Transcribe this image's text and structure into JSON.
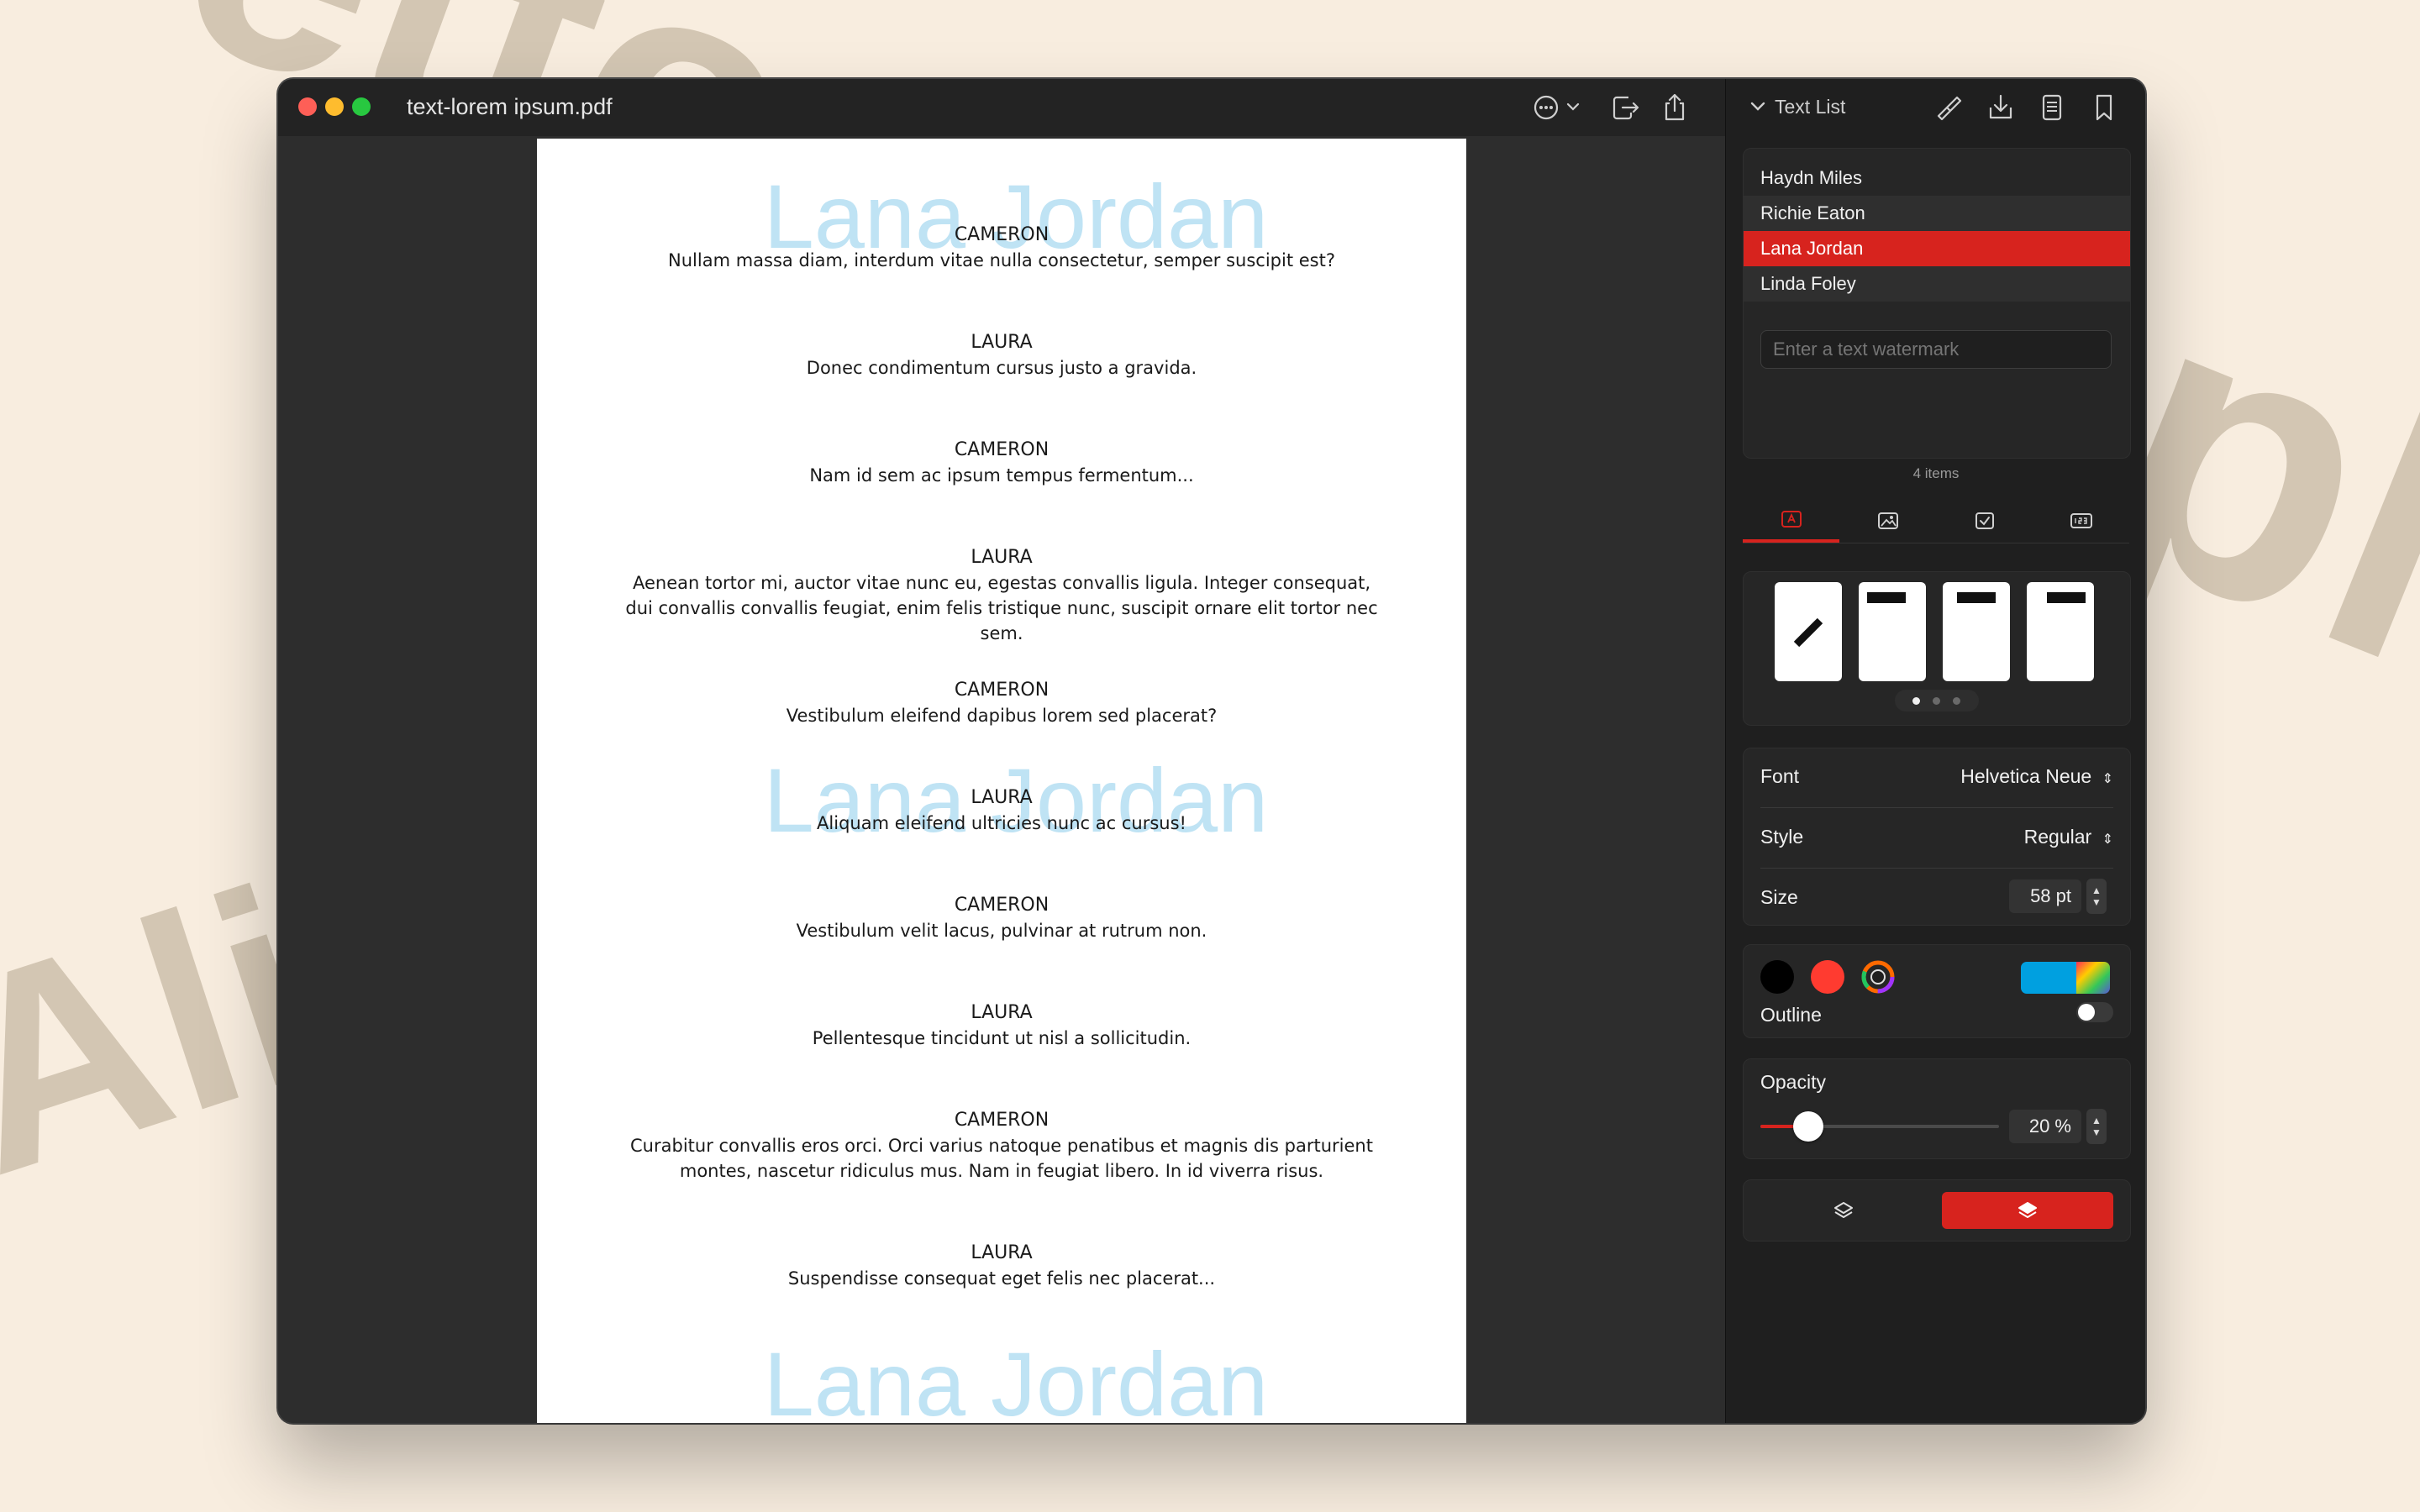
{
  "background": {
    "decor_1": "etto",
    "decor_2": "Alici",
    "decor_3": "ph"
  },
  "window": {
    "title": "text-lorem ipsum.pdf",
    "toolbar": {
      "more_icon": "ellipsis-circle-icon",
      "chevron_icon": "chevron-down-icon",
      "export_icon": "export-icon",
      "share_icon": "share-icon"
    }
  },
  "document": {
    "watermark_text": "Lana Jordan",
    "watermark_color": "#bfe3f4",
    "blocks": [
      {
        "speaker": "CAMERON",
        "text": "Nullam massa diam, interdum vitae nulla consectetur, semper suscipit est?"
      },
      {
        "speaker": "LAURA",
        "text": "Donec condimentum cursus justo a gravida."
      },
      {
        "speaker": "CAMERON",
        "text": "Nam id sem ac ipsum tempus fermentum..."
      },
      {
        "speaker": "LAURA",
        "text": "Aenean tortor mi, auctor vitae nunc eu, egestas convallis ligula. Integer consequat, dui convallis convallis feugiat, enim felis tristique nunc, suscipit ornare elit tortor nec sem."
      },
      {
        "speaker": "CAMERON",
        "text": "Vestibulum eleifend dapibus lorem sed placerat?"
      },
      {
        "speaker": "LAURA",
        "text": "Aliquam eleifend ultricies nunc ac cursus!"
      },
      {
        "speaker": "CAMERON",
        "text": "Vestibulum velit lacus, pulvinar at rutrum non."
      },
      {
        "speaker": "LAURA",
        "text": "Pellentesque tincidunt ut nisl a sollicitudin."
      },
      {
        "speaker": "CAMERON",
        "text": "Curabitur convallis eros orci. Orci varius natoque penatibus et magnis dis parturient montes, nascetur ridiculus mus. Nam in feugiat libero. In id viverra risus."
      },
      {
        "speaker": "LAURA",
        "text": "Suspendisse consequat eget felis nec placerat..."
      }
    ]
  },
  "sidebar": {
    "header": {
      "title": "Text List",
      "icons": [
        "chevron-down-icon",
        "brush-icon",
        "download-tray-icon",
        "document-icon",
        "bookmark-icon"
      ]
    },
    "list": {
      "items": [
        {
          "label": "Haydn Miles",
          "selected": false
        },
        {
          "label": "Richie Eaton",
          "selected": false
        },
        {
          "label": "Lana Jordan",
          "selected": true
        },
        {
          "label": "Linda Foley",
          "selected": false
        }
      ],
      "input_placeholder": "Enter a text watermark",
      "count_label": "4 items"
    },
    "tabs": [
      "text-watermark-icon",
      "image-watermark-icon",
      "checkbox-icon",
      "page-number-icon"
    ],
    "active_tab": 0,
    "presets": {
      "count": 4,
      "page_dots": 3,
      "active_dot": 0
    },
    "font": {
      "label": "Font",
      "value": "Helvetica Neue"
    },
    "style": {
      "label": "Style",
      "value": "Regular"
    },
    "size": {
      "label": "Size",
      "value": "58 pt"
    },
    "colors": {
      "swatches": [
        "#000000",
        "#ff3b30"
      ],
      "picker_icon": "color-wheel-icon",
      "current": "#00a0e0"
    },
    "outline": {
      "label": "Outline",
      "enabled": false
    },
    "opacity": {
      "label": "Opacity",
      "value": "20 %",
      "fraction": 0.2
    },
    "layer": {
      "below_icon": "layer-below-icon",
      "above_icon": "layer-above-icon",
      "active": "above"
    },
    "accent": "#d7231e"
  }
}
